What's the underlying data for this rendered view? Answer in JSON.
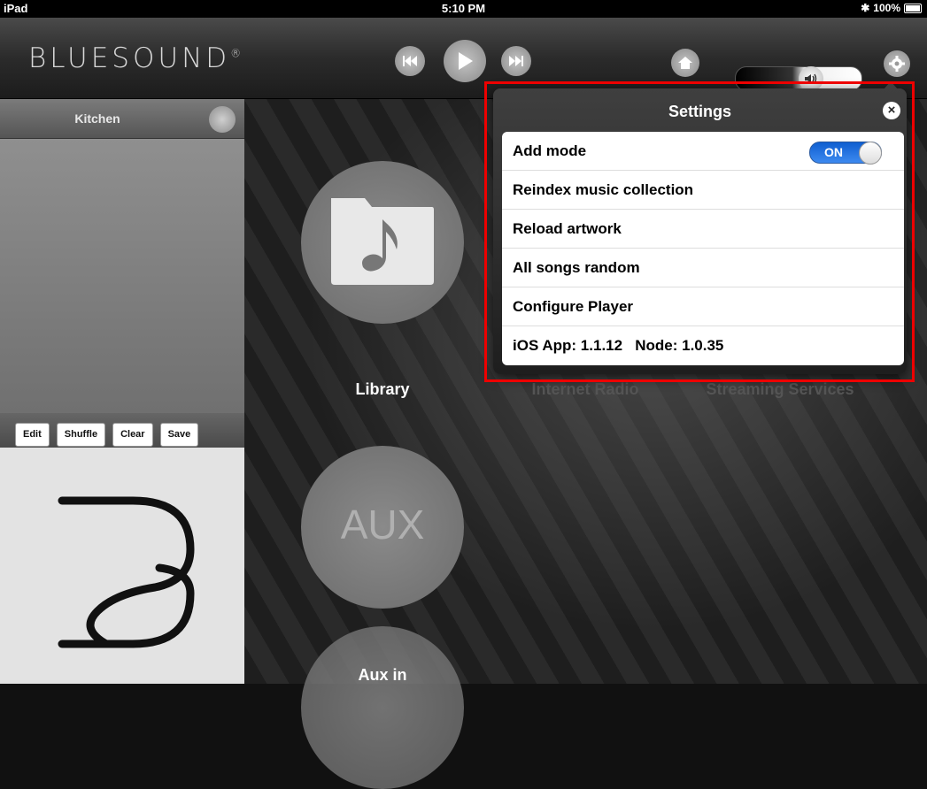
{
  "statusbar": {
    "device": "iPad",
    "time": "5:10 PM",
    "battery": "100%"
  },
  "header": {
    "logo": "BLUESOUND",
    "logo_mark": "®"
  },
  "icons": {
    "previous": "previous-track-icon",
    "play": "play-icon",
    "next": "next-track-icon",
    "home": "home-icon",
    "volume": "speaker-icon",
    "settings": "gear-icon"
  },
  "volume": {
    "level": 0.62
  },
  "sidebar": {
    "zone_name": "Kitchen",
    "queue_buttons": [
      "Edit",
      "Shuffle",
      "Clear",
      "Save"
    ]
  },
  "main": {
    "tiles": {
      "library": "Library",
      "internet_radio": "Internet Radio",
      "streaming_services": "Streaming Services",
      "aux": "AUX",
      "aux_in": "Aux in"
    }
  },
  "settings": {
    "title": "Settings",
    "items": [
      {
        "label": "Add mode",
        "toggle": "ON"
      },
      {
        "label": "Reindex music collection"
      },
      {
        "label": "Reload artwork"
      },
      {
        "label": "All songs random"
      },
      {
        "label": "Configure Player"
      },
      {
        "label": "iOS App: 1.1.12   Node: 1.0.35"
      }
    ]
  },
  "colors": {
    "accent": "#1d6fe0",
    "highlight": "#e00000"
  }
}
